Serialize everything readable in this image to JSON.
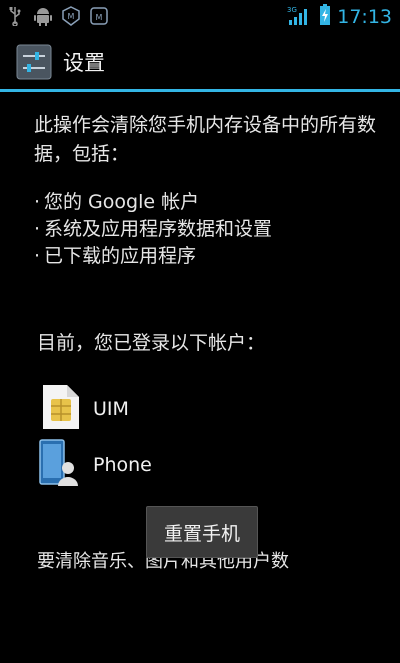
{
  "status_bar": {
    "time": "17:13",
    "icons": [
      "usb-icon",
      "android-icon",
      "notification-m-icon",
      "notification-m2-icon",
      "signal-3g-icon",
      "battery-charging-icon"
    ],
    "accent": "#33b5e5"
  },
  "action_bar": {
    "title": "设置",
    "icon": "settings-app-icon"
  },
  "content": {
    "intro": "此操作会清除您手机内存设备中的所有数据，包括：",
    "bullets": [
      "您的 Google 帐户",
      "系统及应用程序数据和设置",
      "已下载的应用程序"
    ],
    "logged_in_intro": "目前，您已登录以下帐户：",
    "accounts": [
      {
        "label": "UIM",
        "icon": "sim-card-icon"
      },
      {
        "label": "Phone",
        "icon": "phone-contact-icon"
      }
    ],
    "more_text": "要清除音乐、图片和其他用户数"
  },
  "reset_button": {
    "label": "重置手机"
  }
}
